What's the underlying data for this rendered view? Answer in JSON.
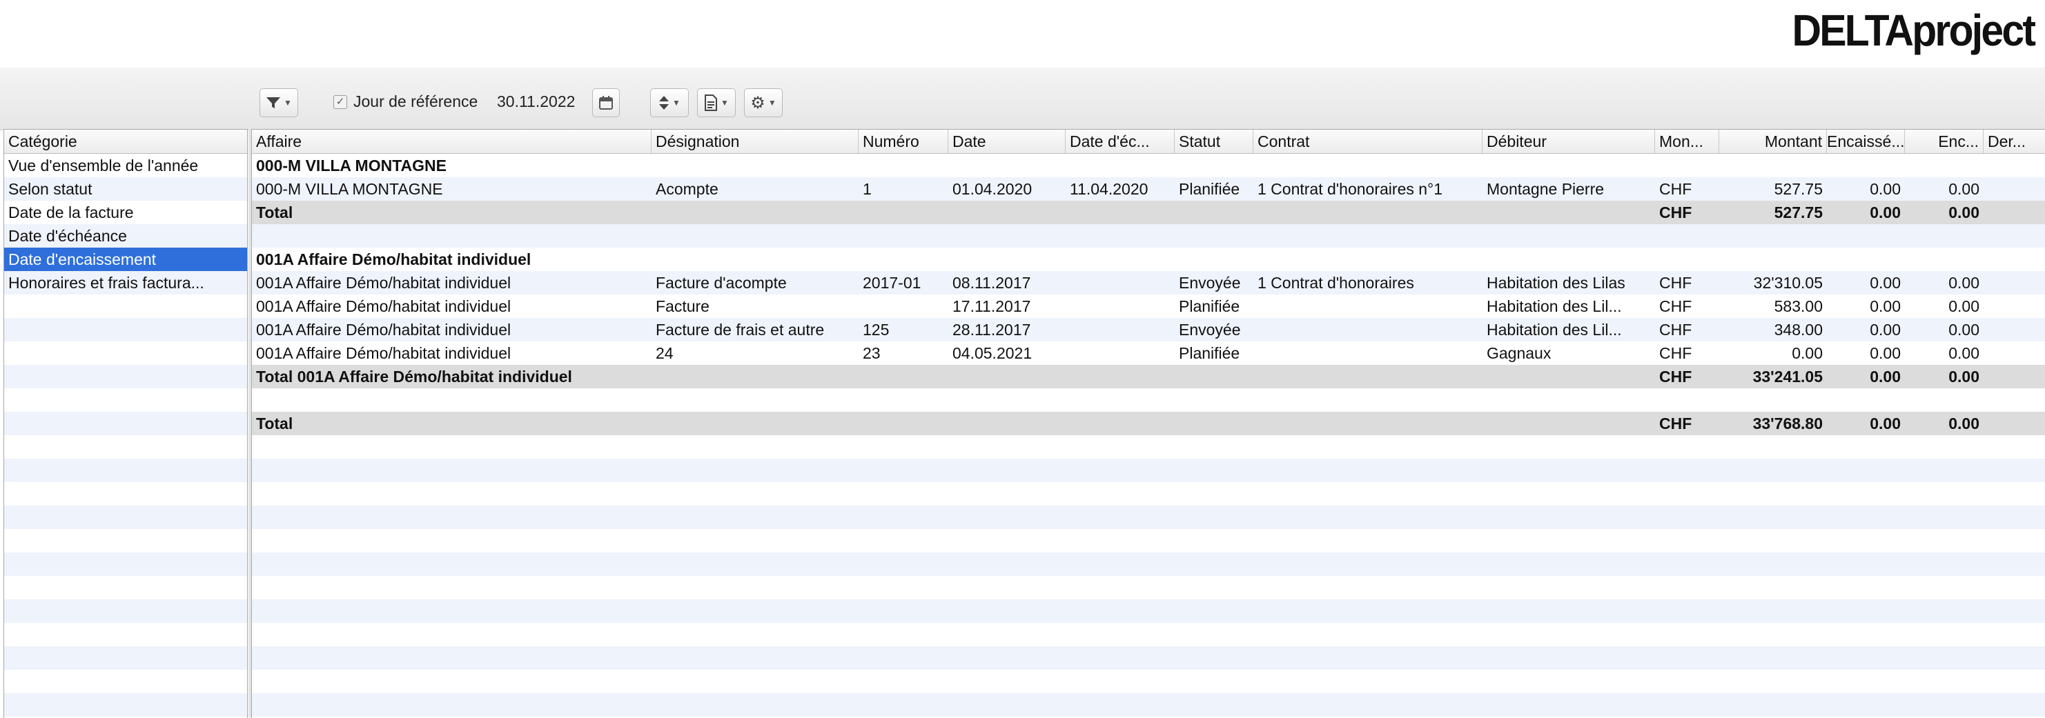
{
  "brand": {
    "logo": "DELTAproject"
  },
  "toolbar": {
    "ref_label": "Jour de référence",
    "ref_date": "30.11.2022",
    "ref_checked": true
  },
  "sidebar": {
    "header": "Catégorie",
    "items": [
      {
        "label": "Vue d'ensemble de l'année",
        "selected": false
      },
      {
        "label": "Selon statut",
        "selected": false
      },
      {
        "label": "Date de la facture",
        "selected": false
      },
      {
        "label": "Date d'échéance",
        "selected": false
      },
      {
        "label": "Date d'encaissement",
        "selected": true
      },
      {
        "label": "Honoraires et frais factura...",
        "selected": false
      }
    ]
  },
  "table": {
    "columns": [
      "Affaire",
      "Désignation",
      "Numéro",
      "Date",
      "Date d'éc...",
      "Statut",
      "Contrat",
      "Débiteur",
      "Mon...",
      "Montant",
      "Encaissé...",
      "Enc...",
      "Der..."
    ],
    "rows": [
      {
        "kind": "group",
        "cells": [
          "000-M VILLA MONTAGNE",
          "",
          "",
          "",
          "",
          "",
          "",
          "",
          "",
          "",
          "",
          "",
          ""
        ]
      },
      {
        "kind": "data",
        "cells": [
          "000-M VILLA MONTAGNE",
          "Acompte",
          "1",
          "01.04.2020",
          "11.04.2020",
          "Planifiée",
          "1 Contrat d'honoraires n°1",
          "Montagne Pierre",
          "CHF",
          "527.75",
          "0.00",
          "0.00",
          ""
        ]
      },
      {
        "kind": "total",
        "cells": [
          "Total",
          "",
          "",
          "",
          "",
          "",
          "",
          "",
          "CHF",
          "527.75",
          "0.00",
          "0.00",
          ""
        ]
      },
      {
        "kind": "blank",
        "cells": [
          "",
          "",
          "",
          "",
          "",
          "",
          "",
          "",
          "",
          "",
          "",
          "",
          ""
        ]
      },
      {
        "kind": "group",
        "cells": [
          "001A Affaire Démo/habitat individuel",
          "",
          "",
          "",
          "",
          "",
          "",
          "",
          "",
          "",
          "",
          "",
          ""
        ]
      },
      {
        "kind": "data",
        "cells": [
          "001A Affaire Démo/habitat individuel",
          "Facture d'acompte",
          "2017-01",
          "08.11.2017",
          "",
          "Envoyée",
          "1 Contrat d'honoraires",
          "Habitation des Lilas",
          "CHF",
          "32'310.05",
          "0.00",
          "0.00",
          ""
        ]
      },
      {
        "kind": "data",
        "cells": [
          "001A Affaire Démo/habitat individuel",
          "Facture",
          "",
          "17.11.2017",
          "",
          "Planifiée",
          "",
          "Habitation des Lil...",
          "CHF",
          "583.00",
          "0.00",
          "0.00",
          ""
        ]
      },
      {
        "kind": "data",
        "cells": [
          "001A Affaire Démo/habitat individuel",
          "Facture de frais et autre",
          "125",
          "28.11.2017",
          "",
          "Envoyée",
          "",
          "Habitation des Lil...",
          "CHF",
          "348.00",
          "0.00",
          "0.00",
          ""
        ]
      },
      {
        "kind": "data",
        "cells": [
          "001A Affaire Démo/habitat individuel",
          "24",
          "23",
          "04.05.2021",
          "",
          "Planifiée",
          "",
          "Gagnaux",
          "CHF",
          "0.00",
          "0.00",
          "0.00",
          ""
        ]
      },
      {
        "kind": "total",
        "cells": [
          "Total 001A Affaire Démo/habitat individuel",
          "",
          "",
          "",
          "",
          "",
          "",
          "",
          "CHF",
          "33'241.05",
          "0.00",
          "0.00",
          ""
        ]
      },
      {
        "kind": "blank",
        "cells": [
          "",
          "",
          "",
          "",
          "",
          "",
          "",
          "",
          "",
          "",
          "",
          "",
          ""
        ]
      },
      {
        "kind": "total",
        "cells": [
          "Total",
          "",
          "",
          "",
          "",
          "",
          "",
          "",
          "CHF",
          "33'768.80",
          "0.00",
          "0.00",
          ""
        ]
      }
    ]
  },
  "icons": {
    "filter": "filter-icon",
    "calendar": "calendar-icon",
    "sort": "sort-icon",
    "export": "document-icon",
    "settings": "gear-icon"
  },
  "colors": {
    "selection": "#2e6fdb",
    "stripe": "#eff3fb",
    "total": "#dcdcdc"
  }
}
